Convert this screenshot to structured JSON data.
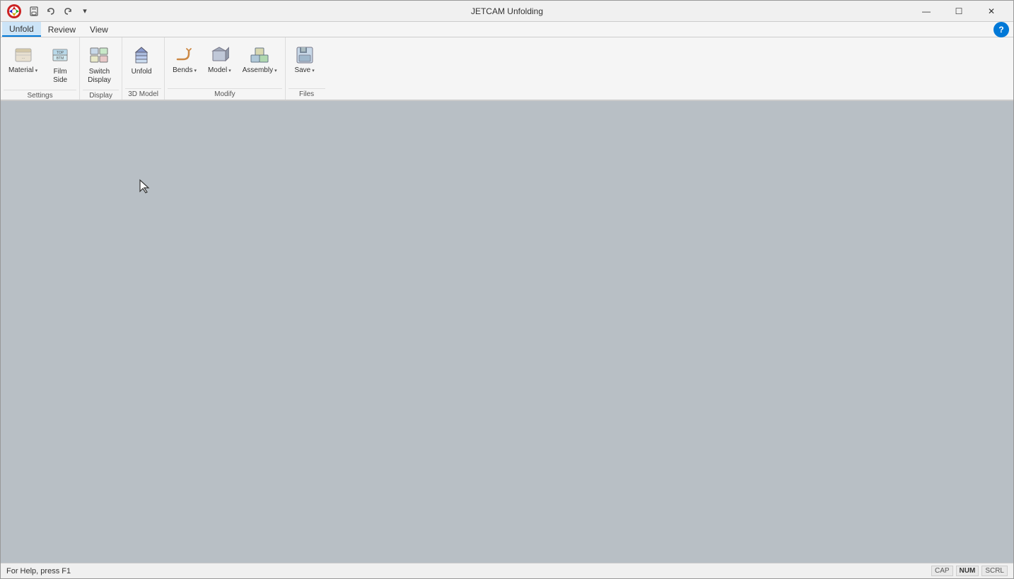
{
  "titleBar": {
    "title": "JETCAM Unfolding",
    "quickAccess": [
      "save",
      "undo",
      "redo",
      "dropdown"
    ]
  },
  "menuBar": {
    "items": [
      "Unfold",
      "Review",
      "View"
    ],
    "active": "Unfold"
  },
  "ribbon": {
    "groups": [
      {
        "label": "Settings",
        "buttons": [
          {
            "id": "material",
            "label": "Material",
            "hasArrow": true
          },
          {
            "id": "film-side",
            "label": "Film\nSide",
            "hasArrow": false
          }
        ]
      },
      {
        "label": "Display",
        "buttons": [
          {
            "id": "switch",
            "label": "Switch\nDisplay",
            "hasArrow": false
          }
        ]
      },
      {
        "label": "3D Model",
        "buttons": [
          {
            "id": "unfold",
            "label": "Unfold",
            "hasArrow": false
          }
        ]
      },
      {
        "label": "Modify",
        "buttons": [
          {
            "id": "bends",
            "label": "Bends",
            "hasArrow": true
          },
          {
            "id": "model",
            "label": "Model",
            "hasArrow": true
          },
          {
            "id": "assembly",
            "label": "Assembly",
            "hasArrow": true
          }
        ]
      },
      {
        "label": "Files",
        "buttons": [
          {
            "id": "save",
            "label": "Save",
            "hasArrow": true
          }
        ]
      }
    ]
  },
  "statusBar": {
    "helpText": "For Help, press F1",
    "indicators": [
      "CAP",
      "NUM",
      "SCRL"
    ]
  },
  "canvas": {
    "background": "#b8bfc5"
  }
}
